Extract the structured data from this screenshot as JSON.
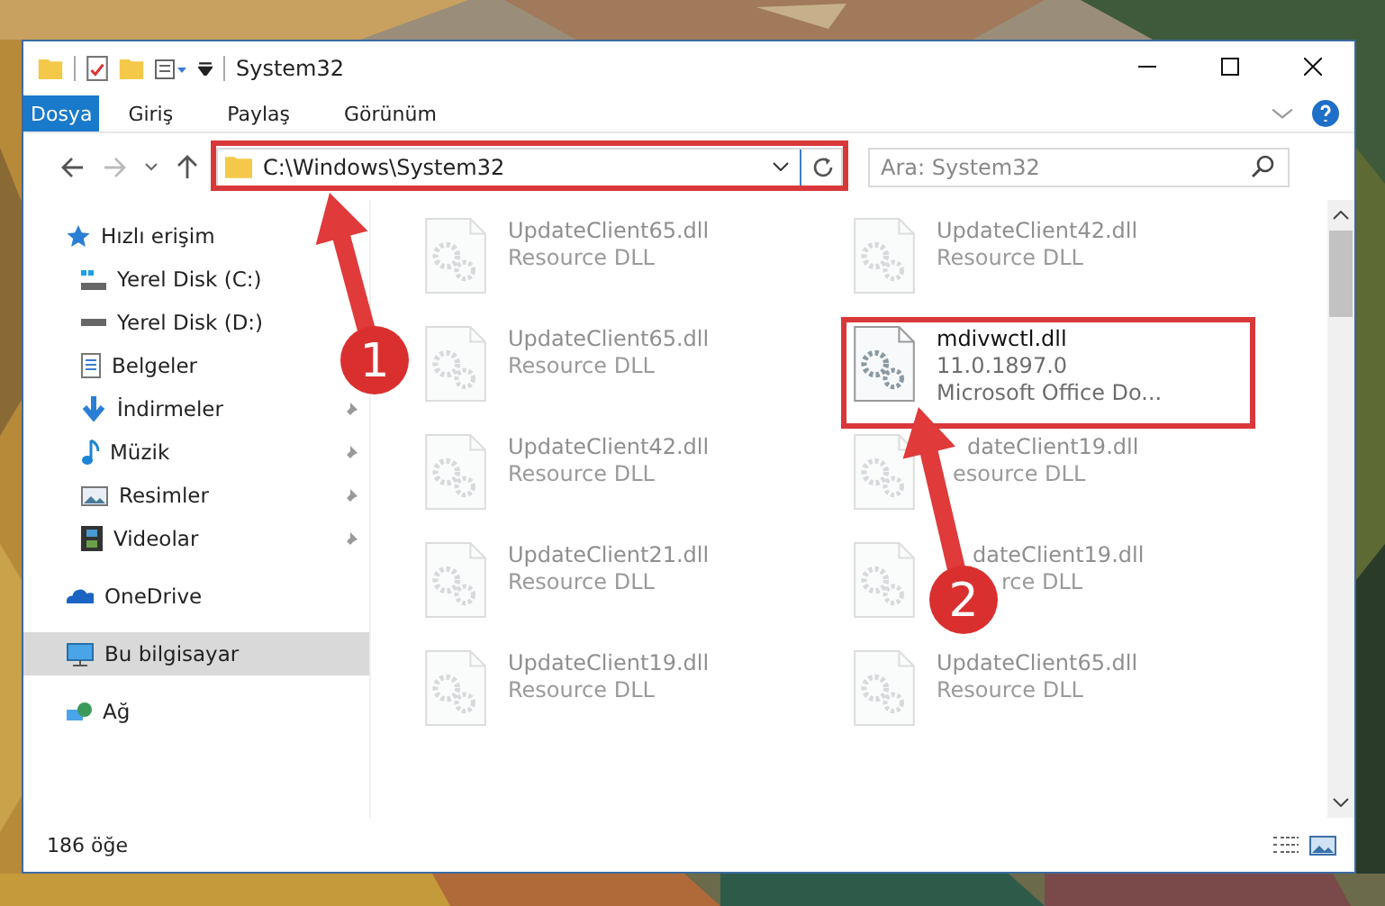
{
  "window": {
    "title": "System32"
  },
  "ribbon_tabs": [
    {
      "label": "Dosya",
      "kind": "file"
    },
    {
      "label": "Giriş",
      "kind": "tab"
    },
    {
      "label": "Paylaş",
      "kind": "tab"
    },
    {
      "label": "Görünüm",
      "kind": "tab"
    }
  ],
  "address": {
    "path": "C:\\Windows\\System32"
  },
  "search": {
    "placeholder": "Ara: System32"
  },
  "sidebar": {
    "items": [
      {
        "label": "Hızlı erişim",
        "kind": "star",
        "selected": false,
        "children": [
          {
            "label": "Yerel Disk (C:)",
            "kind": "drive-c",
            "pinned": false,
            "selected": false
          },
          {
            "label": "Yerel Disk (D:)",
            "kind": "drive",
            "pinned": false,
            "selected": false
          },
          {
            "label": "Belgeler",
            "kind": "documents",
            "pinned": false,
            "selected": false
          },
          {
            "label": "İndirmeler",
            "kind": "download",
            "pinned": true,
            "selected": false
          },
          {
            "label": "Müzik",
            "kind": "music",
            "pinned": true,
            "selected": false
          },
          {
            "label": "Resimler",
            "kind": "pictures",
            "pinned": true,
            "selected": false
          },
          {
            "label": "Videolar",
            "kind": "videos",
            "pinned": true,
            "selected": false
          }
        ]
      },
      {
        "label": "OneDrive",
        "kind": "cloud",
        "selected": false
      },
      {
        "label": "Bu bilgisayar",
        "kind": "computer",
        "selected": true
      },
      {
        "label": "Ağ",
        "kind": "network",
        "selected": false
      }
    ]
  },
  "files": [
    {
      "name": "UpdateClient65.dll",
      "details": [
        "Resource DLL"
      ],
      "selected": false
    },
    {
      "name": "UpdateClient42.dll",
      "details": [
        "Resource DLL"
      ],
      "selected": false
    },
    {
      "name": "UpdateClient65.dll",
      "details": [
        "Resource DLL"
      ],
      "selected": false
    },
    {
      "name": "mdivwctl.dll",
      "details": [
        "11.0.1897.0",
        "Microsoft Office Do..."
      ],
      "selected": true
    },
    {
      "name": "UpdateClient42.dll",
      "details": [
        "Resource DLL"
      ],
      "selected": false
    },
    {
      "name": "dateClient19.dll",
      "details": [
        "esource DLL"
      ],
      "selected": false
    },
    {
      "name": "UpdateClient21.dll",
      "details": [
        "Resource DLL"
      ],
      "selected": false
    },
    {
      "name": "dateClient19.dll",
      "details": [
        "rce DLL"
      ],
      "selected": false
    },
    {
      "name": "UpdateClient19.dll",
      "details": [
        "Resource DLL"
      ],
      "selected": false
    },
    {
      "name": "UpdateClient65.dll",
      "details": [
        "Resource DLL"
      ],
      "selected": false
    }
  ],
  "status_bar": {
    "count": "186 öğe"
  },
  "callouts": [
    {
      "number": "1"
    },
    {
      "number": "2"
    }
  ]
}
